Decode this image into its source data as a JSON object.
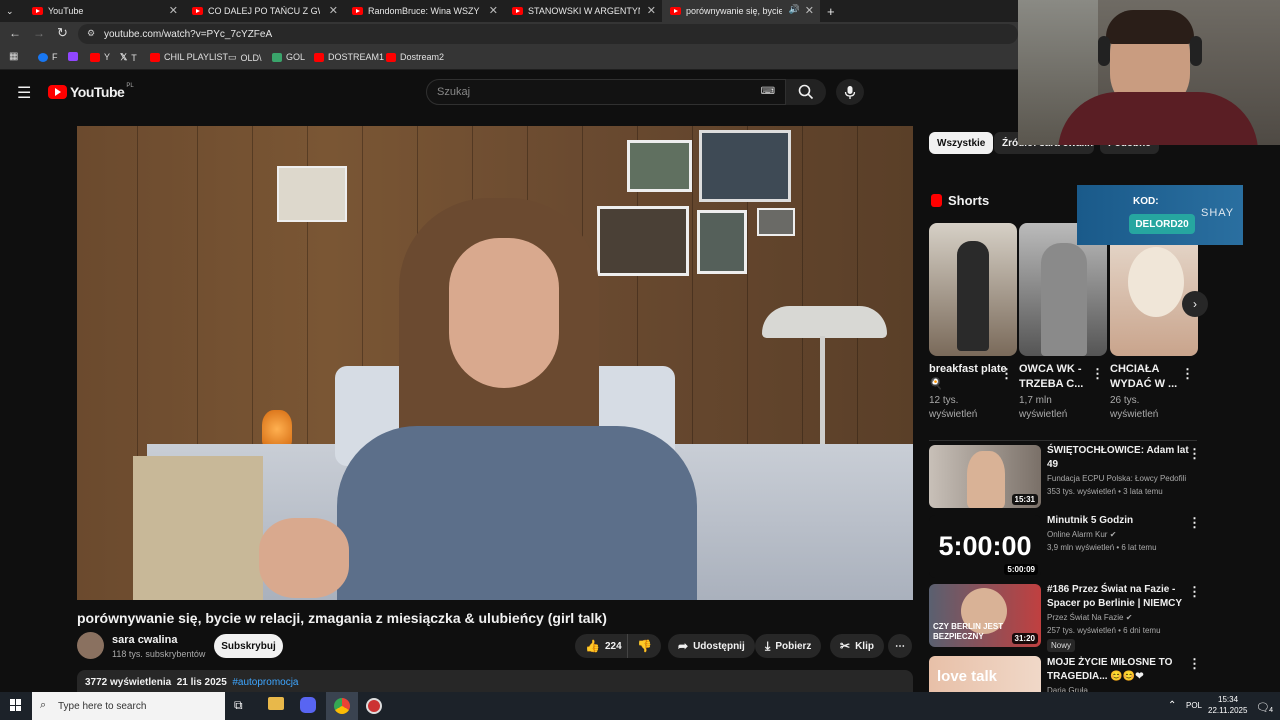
{
  "browser": {
    "tabs": [
      {
        "title": "YouTube"
      },
      {
        "title": "CO DALEJ PO TAŃCU Z GWIAZ"
      },
      {
        "title": "RandomBruce: Wina WSZYSTKI"
      },
      {
        "title": "STANOWSKI W ARGENTYNIE: M"
      },
      {
        "title": "porównywanie się, bycie w"
      }
    ],
    "url": "youtube.com/watch?v=PYc_7cYZFeA",
    "bookmarks": [
      {
        "label": "F"
      },
      {
        "label": "T"
      },
      {
        "label": "Y"
      },
      {
        "label": "T"
      },
      {
        "label": "CHIL PLAYLIST"
      },
      {
        "label": "OLD\\"
      },
      {
        "label": "GOL"
      },
      {
        "label": "DOSTREAM1"
      },
      {
        "label": "Dostream2"
      }
    ]
  },
  "youtube": {
    "logo": "YouTube",
    "region": "PL",
    "search_placeholder": "Szukaj"
  },
  "video": {
    "title": "porównywanie się, bycie w relacji, zmagania z miesiączka & ulubieńcy (girl talk)",
    "channel": "sara cwalina",
    "subscribers": "118 tys. subskrybentów",
    "subscribe_label": "Subskrybuj",
    "likes": "224",
    "share_label": "Udostępnij",
    "download_label": "Pobierz",
    "clip_label": "Klip",
    "views": "3772 wyświetlenia",
    "date": "21 lis 2025",
    "hashtag": "#autopromocja"
  },
  "sidebar": {
    "chips": [
      {
        "label": "Wszystkie"
      },
      {
        "label": "Źródło: sara cwalina"
      },
      {
        "label": "Podobne"
      }
    ],
    "shorts_label": "Shorts",
    "shorts": [
      {
        "title": "breakfast plate 🍳",
        "views": "12 tys. wyświetleń"
      },
      {
        "title": "OWCA WK - TRZEBA C...",
        "views": "1,7 mln wyświetleń"
      },
      {
        "title": "CHCIAŁA WYDAĆ W ...",
        "views": "26 tys. wyświetleń"
      }
    ],
    "promo": {
      "kod_label": "KOD:",
      "code": "DELORD20",
      "brand": "SHAY"
    },
    "related": [
      {
        "title": "ŚWIĘTOCHŁOWICE: Adam lat 49",
        "channel": "Fundacja ECPU Polska: Łowcy Pedofili",
        "meta": "353 tys. wyświetleń • 3 lata temu",
        "duration": "15:31"
      },
      {
        "title": "Minutnik 5 Godzin",
        "channel": "Online Alarm Kur",
        "meta": "3,9 mln wyświetleń • 6 lat temu",
        "duration": "5:00:09",
        "thumb_text": "5:00:00"
      },
      {
        "title": "#186 Przez Świat na Fazie - Spacer po Berlinie | NIEMCY",
        "channel": "Przez Świat Na Fazie",
        "meta": "257 tys. wyświetleń • 6 dni temu",
        "badge": "Nowy",
        "duration": "31:20",
        "thumb_text": "CZY BERLIN JEST BEZPIECZNY"
      },
      {
        "title": "MOJE ŻYCIE MIŁOSNE TO TRAGEDIA... 😊😊❤",
        "channel": "Daria Gruła",
        "thumb_text": "love talk"
      }
    ]
  },
  "taskbar": {
    "search_placeholder": "Type here to search",
    "language": "POL",
    "time": "15:34",
    "date": "22.11.2025",
    "notifications": "4"
  }
}
